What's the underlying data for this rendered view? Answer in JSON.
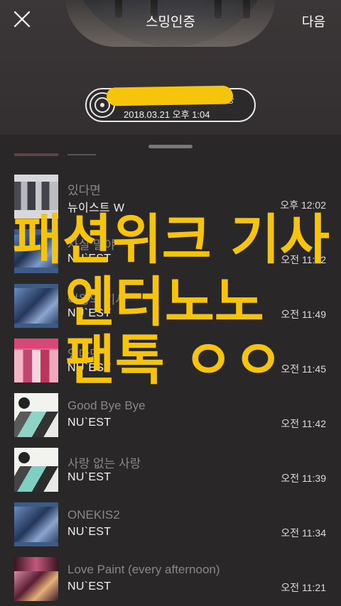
{
  "header": {
    "title": "스밍인증",
    "next_label": "다음"
  },
  "proof": {
    "song_text": "증",
    "datetime": "2018.03.21 오후 1:04"
  },
  "rows": [
    {
      "title": "있다면",
      "artist": "뉴이스트 W",
      "time": "오후 12:02"
    },
    {
      "title": "사실 말야",
      "artist": "NU`EST",
      "time": "오전 11:52"
    },
    {
      "title": "여왕의 기사",
      "artist": "NU`EST",
      "time": "오전 11:49"
    },
    {
      "title": "있다면",
      "artist": "NU`EST",
      "time": "오전 11:45"
    },
    {
      "title": "Good Bye Bye",
      "artist": "NU`EST",
      "time": "오전 11:42"
    },
    {
      "title": "사랑 없는 사랑",
      "artist": "NU`EST",
      "time": "오전 11:39"
    },
    {
      "title": "ONEKIS2",
      "artist": "NU`EST",
      "time": "오전 11:34"
    },
    {
      "title": "Love Paint (every afternoon)",
      "artist": "NU`EST",
      "time": "오전 11:21"
    }
  ],
  "overlay": {
    "line1": "패션위크 기사",
    "line2": "엔터노노",
    "line3": "팬톡 ㅇㅇ"
  },
  "colors": {
    "accent": "#f6c40b",
    "background": "#2a2728"
  }
}
